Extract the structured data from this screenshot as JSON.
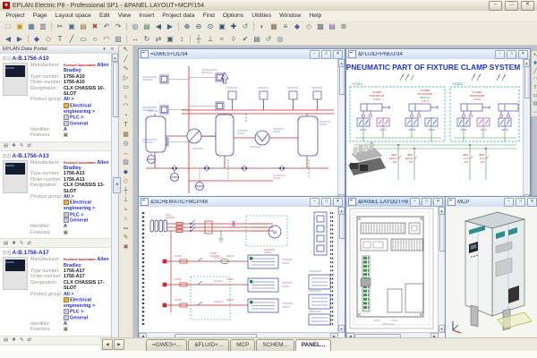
{
  "window": {
    "title": "EPLAN Electric P8 - Professional SP1 - &PANEL LAYOUT+MCP/154",
    "logo": "e"
  },
  "glyphs": {
    "min": "–",
    "max": "□",
    "close": "✕",
    "up": "▲",
    "down": "▼",
    "left": "◀",
    "right": "▶",
    "pin": "▾",
    "x": "✕",
    "collapse": "◂"
  },
  "menu": [
    "Project",
    "Page",
    "Layout space",
    "Edit",
    "View",
    "Insert",
    "Project data",
    "Find",
    "Options",
    "Utilities",
    "Window",
    "Help"
  ],
  "toolbar1": [
    [
      "new-page",
      "□",
      "#777777"
    ],
    [
      "open-project",
      "▣",
      "#c79420"
    ],
    [
      "save",
      "▦",
      "#3a6a8a"
    ],
    [
      "print",
      "▥",
      "#5a6a88"
    ],
    "|",
    [
      "cut",
      "✂",
      "#4a5a70"
    ],
    [
      "copy",
      "▣",
      "#4a6a85"
    ],
    [
      "paste",
      "▤",
      "#96703a"
    ],
    [
      "delete",
      "✖",
      "#b34444"
    ],
    [
      "undo",
      "↶",
      "#3a6a95"
    ],
    [
      "redo",
      "↷",
      "#3a6a95"
    ],
    "|",
    [
      "find",
      "◎",
      "#35608a"
    ],
    [
      "page-navigator",
      "▤",
      "#3a8a55"
    ],
    [
      "previous-page",
      "◀",
      "#35608a"
    ],
    [
      "next-page",
      "▶",
      "#35608a"
    ],
    "|",
    [
      "zoom-in",
      "⊕",
      "#2a5580"
    ],
    [
      "zoom-out",
      "⊖",
      "#2a5580"
    ],
    [
      "zoom-window",
      "⊙",
      "#2a5580"
    ],
    [
      "zoom-100",
      "▣",
      "#2a5580"
    ],
    [
      "pan",
      "✚",
      "#2a5580"
    ],
    [
      "redraw",
      "↺",
      "#4a8a60"
    ],
    "|",
    [
      "graphical-preview",
      "◐",
      "#667080"
    ],
    [
      "device-navigator",
      "▦",
      "#8a6a45"
    ],
    [
      "parts-database",
      "≡",
      "#556070"
    ],
    [
      "symbol-selection",
      "◆",
      "#5555a5"
    ],
    [
      "window-macro",
      "◇",
      "#a05555"
    ],
    [
      "properties",
      "▩",
      "#557080"
    ],
    [
      "layers",
      "▤",
      "#76569a"
    ],
    [
      "settings",
      "⊛",
      "#566a5a"
    ]
  ],
  "toolbar2": [
    [
      "back",
      "◀",
      "#46699a"
    ],
    [
      "forward",
      "▶",
      "#46699a"
    ],
    "|",
    [
      "insert-symbol",
      "◆",
      "#5555a5"
    ],
    [
      "insert-window-macro",
      "◇",
      "#a05555"
    ],
    [
      "insert-text",
      "T",
      "#1a8035"
    ],
    [
      "insert-line",
      "╱",
      "#355a80"
    ],
    [
      "insert-rectangle",
      "▭",
      "#355a80"
    ],
    [
      "insert-circle",
      "○",
      "#355a80"
    ],
    [
      "insert-arc",
      "◠",
      "#355a80"
    ],
    [
      "insert-hatch",
      "▨",
      "#56708a"
    ],
    "|",
    [
      "move",
      "↔",
      "#4a5a70"
    ],
    [
      "rotate",
      "↻",
      "#4a5a70"
    ],
    [
      "mirror",
      "⇄",
      "#4a5a70"
    ],
    [
      "group",
      "▣",
      "#4a5a70"
    ],
    [
      "stretch",
      "↕",
      "#4a5a70"
    ],
    "|",
    [
      "connection-symbol",
      "┼",
      "#355a80"
    ],
    [
      "terminal",
      "⊥",
      "#355a80"
    ],
    [
      "cable-definition",
      "≈",
      "#7a6040"
    ],
    [
      "interruption-point",
      "◊",
      "#5560a0"
    ],
    [
      "check-project",
      "✔",
      "#2a8a3a"
    ],
    [
      "reports",
      "▤",
      "#556070"
    ],
    [
      "update-project",
      "↺",
      "#4a8a60"
    ],
    [
      "data-portal",
      "◎",
      "#3a6a95"
    ]
  ],
  "side_toolbar": [
    [
      "selection",
      "↖",
      "#44506a"
    ],
    [
      "graphic-line",
      "╱",
      "#35608a"
    ],
    [
      "polyline",
      "∿",
      "#35608a"
    ],
    [
      "polygon",
      "▷",
      "#35608a"
    ],
    [
      "rectangle",
      "▭",
      "#35608a"
    ],
    [
      "circle",
      "○",
      "#35608a"
    ],
    [
      "arc",
      "◠",
      "#35608a"
    ],
    [
      "sector",
      "◔",
      "#35608a"
    ],
    [
      "text",
      "T",
      "#1a8035"
    ],
    [
      "image",
      "▦",
      "#86654a"
    ],
    [
      "hyperlink",
      "◎",
      "#35608a"
    ],
    [
      "dimension",
      "↔",
      "#7a5555"
    ],
    [
      "hatch",
      "▨",
      "#56708a"
    ],
    [
      "symbol",
      "◆",
      "#5555a5"
    ],
    [
      "macro",
      "◇",
      "#a05555"
    ],
    [
      "connection",
      "┼",
      "#35608a"
    ],
    [
      "terminal-strip",
      "⊥",
      "#35608a"
    ],
    [
      "cable",
      "≈",
      "#7a6040"
    ],
    [
      "shield",
      "∩",
      "#56708a"
    ],
    [
      "busbar",
      "═",
      "#6a5a45"
    ],
    [
      "edit",
      "✎",
      "#a56a20"
    ],
    [
      "erase",
      "✖",
      "#b34444"
    ]
  ],
  "right_strip": [
    [
      "select",
      "↖",
      "#44506a"
    ],
    [
      "snap",
      "✚",
      "#35608a"
    ],
    [
      "draw-line",
      "╱",
      "#35608a"
    ],
    [
      "draw-arc",
      "◠",
      "#35608a"
    ],
    [
      "place-text",
      "T",
      "#1a8035"
    ],
    [
      "place-box",
      "▭",
      "#35608a"
    ],
    [
      "place-hatch",
      "▨",
      "#56708a"
    ],
    [
      "measure",
      "↔",
      "#7a5555"
    ]
  ],
  "portal": {
    "title": "EPLAN Data Portal",
    "labels": {
      "man": "Manufacturer:",
      "type": "Type number:",
      "order": "Order number:",
      "des": "Designation:",
      "pg": "Product group:",
      "id": "Identifier:",
      "feat": "Features:"
    },
    "card_actions": [
      [
        "add-part",
        "▤"
      ],
      [
        "insert-part",
        "✚"
      ],
      [
        "edit-part",
        "✎"
      ],
      [
        "compare-part",
        "⇄"
      ]
    ],
    "items": [
      {
        "num": "[51]",
        "title": "A-B.1756-A10",
        "logo": "Rockwell Automation",
        "manufacturer": "Allen Bradley",
        "type_number": "1756-A10",
        "order_number": "1756-A10",
        "designation": "CLX CHASSIS 10-SLOT",
        "product_group": [
          "All >",
          "Electrical engineering >",
          "PLC >",
          "General"
        ],
        "identifier": "A"
      },
      {
        "num": "[52]",
        "title": "A-B.1756-A13",
        "logo": "Rockwell Automation",
        "manufacturer": "Allen Bradley",
        "type_number": "1756-A13",
        "order_number": "1756-A13",
        "designation": "CLX CHASSIS 13-SLOT",
        "product_group": [
          "All >",
          "Electrical engineering >",
          "PLC >",
          "General"
        ],
        "identifier": "A"
      },
      {
        "num": "[53]",
        "title": "A-B.1756-A17",
        "logo": "Rockwell Automation",
        "manufacturer": "Allen Bradley",
        "type_number": "1756-A17",
        "order_number": "1756-A17",
        "designation": "CLX CHASSIS 17-SLOT",
        "product_group": [
          "All >",
          "Electrical engineering >",
          "PLC >",
          "General"
        ],
        "identifier": "A"
      }
    ]
  },
  "windows": {
    "gwes": {
      "title": "=GWES+O1/34"
    },
    "pneu": {
      "title": "&FLUID+PNEU/34",
      "heading": "PNEUMATIC PART OF FIXTURE CLAMP SYSTEM",
      "sta1": "+STA1",
      "sta2": "+STA2",
      "g1": [
        "CLAMP",
        "STATION #1",
        "CYL2"
      ],
      "g2": [
        "CLAMP",
        "STATION#1",
        "(W/CYL)",
        "CYL3"
      ],
      "g3": [
        "CLAMP",
        "STATION#2",
        "CYL2"
      ],
      "v": [
        "VLV1",
        "VLV2",
        "VLV3",
        "VLV4",
        "VLV1",
        "VLV2",
        "VLV3"
      ],
      "s": [
        [
          "-B03",
          "120 lb",
          "0.5"
        ],
        [
          "-B04",
          "120 lb",
          "0.5"
        ],
        [
          "-B05",
          "2 m",
          "0.5"
        ],
        [
          "-B06",
          "2 m",
          "0.5"
        ]
      ]
    },
    "schem": {
      "title": "&SCHEMATIC+MCP/48"
    },
    "panel": {
      "title": "&PANEL LAYOUT+MCP/154"
    },
    "mcp": {
      "title": "MCP"
    }
  },
  "tabs": [
    {
      "label": "=GWES+...",
      "active": false
    },
    {
      "label": "&FLUID+...",
      "active": false
    },
    {
      "label": "MCP",
      "active": false
    },
    {
      "label": "SCHEM...",
      "active": false
    },
    {
      "label": "PANEL...",
      "active": true
    }
  ]
}
